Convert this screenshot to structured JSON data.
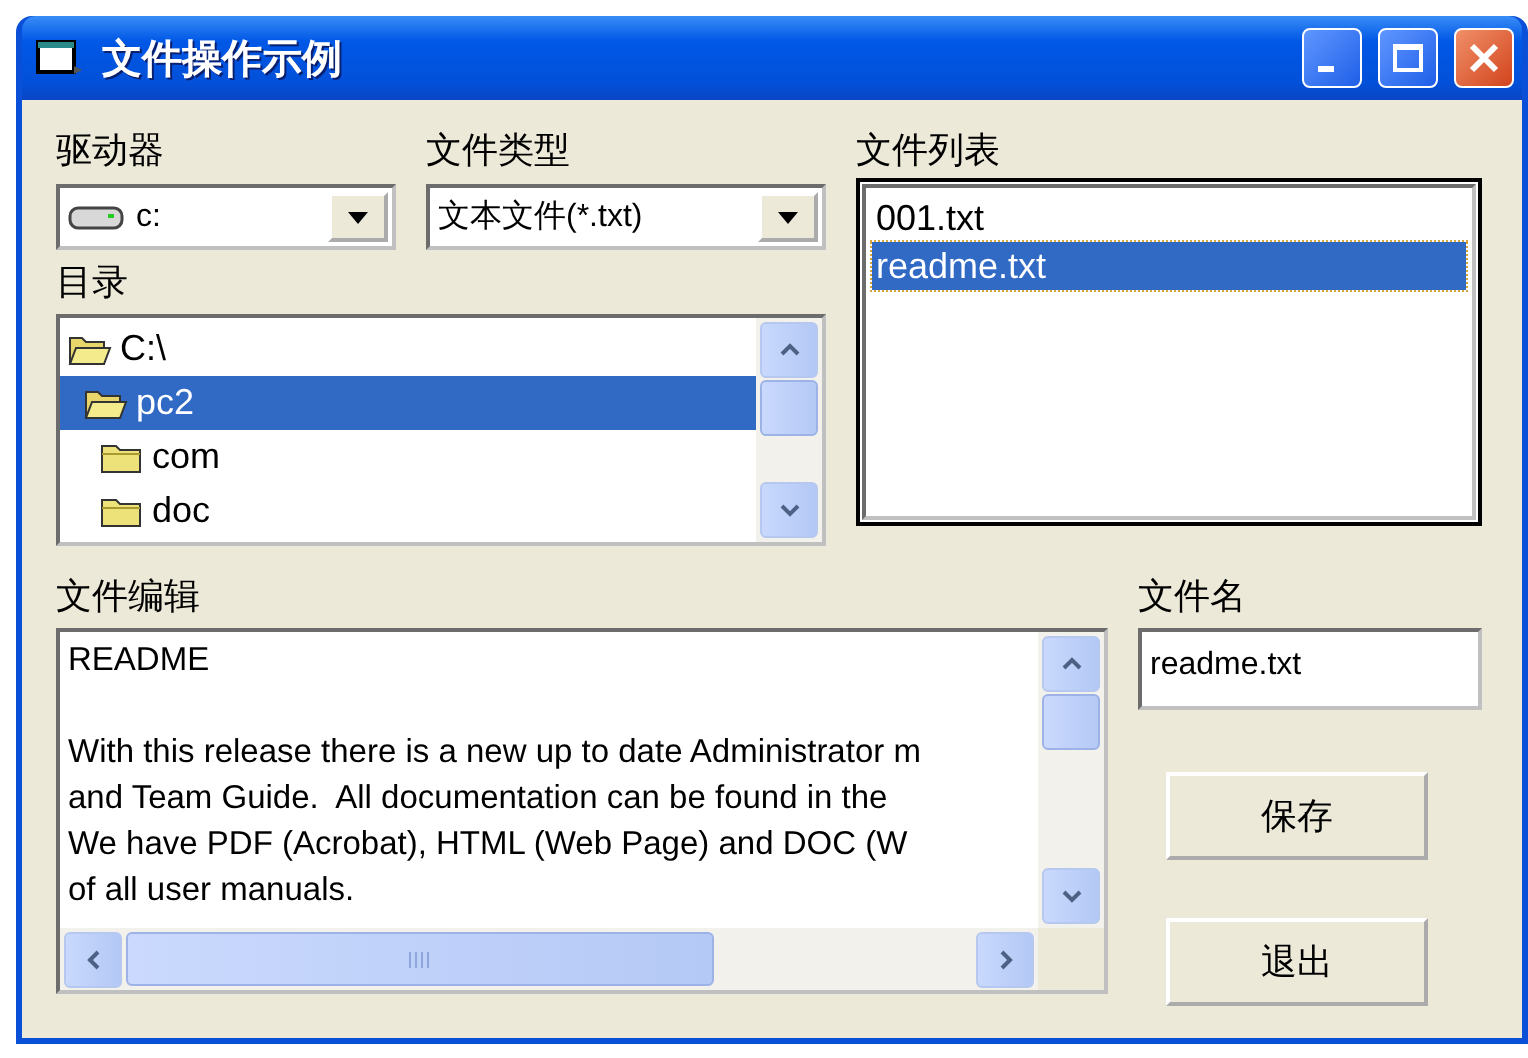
{
  "window": {
    "title": "文件操作示例"
  },
  "drive": {
    "label": "驱动器",
    "value": "c:"
  },
  "file_type": {
    "label": "文件类型",
    "value": "文本文件(*.txt)"
  },
  "directory": {
    "label": "目录",
    "items": [
      {
        "name": "C:\\",
        "expanded": true,
        "selected": false,
        "children": [
          {
            "name": "pc2",
            "expanded": true,
            "selected": true,
            "children": [
              {
                "name": "com",
                "expanded": false,
                "selected": false
              },
              {
                "name": "doc",
                "expanded": false,
                "selected": false
              }
            ]
          }
        ]
      }
    ]
  },
  "file_list": {
    "label": "文件列表",
    "items": [
      {
        "name": "001.txt",
        "selected": false
      },
      {
        "name": "readme.txt",
        "selected": true
      }
    ]
  },
  "editor": {
    "label": "文件编辑",
    "paragraphs": [
      {
        "lines": [
          "README"
        ]
      },
      {
        "lines": [
          "With this release there is a new up to date Administrator m",
          "and Team Guide.  All documentation can be found in the",
          "We have PDF (Acrobat), HTML (Web Page) and DOC (W",
          "of all user manuals."
        ]
      }
    ]
  },
  "file_name": {
    "label": "文件名",
    "value": "readme.txt"
  },
  "buttons": [
    "保存",
    "退出"
  ]
}
